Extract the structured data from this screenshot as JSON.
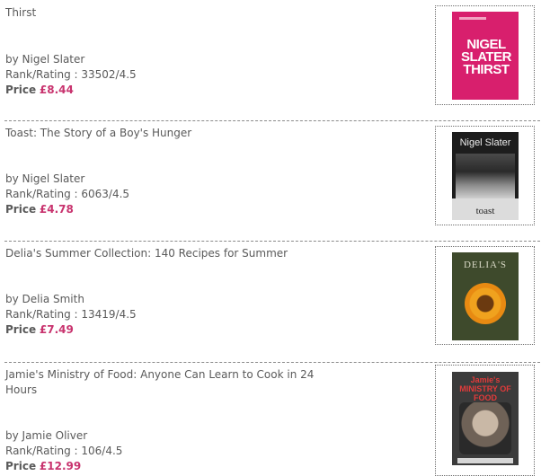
{
  "books": [
    {
      "title": "Thirst",
      "author": "by Nigel Slater",
      "rank": "Rank/Rating : 33502/4.5",
      "price_label": "Price",
      "price": "£8.44",
      "cover_text": "NIGEL SLATER THIRST"
    },
    {
      "title": "Toast: The Story of a Boy's Hunger",
      "author": "by Nigel Slater",
      "rank": "Rank/Rating : 6063/4.5",
      "price_label": "Price",
      "price": "£4.78",
      "cover_author": "Nigel Slater",
      "cover_title": "toast"
    },
    {
      "title": "Delia's Summer Collection: 140 Recipes for Summer",
      "author": "by Delia Smith",
      "rank": "Rank/Rating : 13419/4.5",
      "price_label": "Price",
      "price": "£7.49",
      "cover_title": "DELIA'S"
    },
    {
      "title": "Jamie's Ministry of Food: Anyone Can Learn to Cook in 24 Hours",
      "author": "by Jamie Oliver",
      "rank": "Rank/Rating : 106/4.5",
      "price_label": "Price",
      "price": "£12.99",
      "cover_title": "Jamie's MINISTRY OF FOOD"
    }
  ],
  "colors": {
    "text": "#5a5a5a",
    "price": "#c8336e",
    "separator": "#8a8a8a"
  }
}
